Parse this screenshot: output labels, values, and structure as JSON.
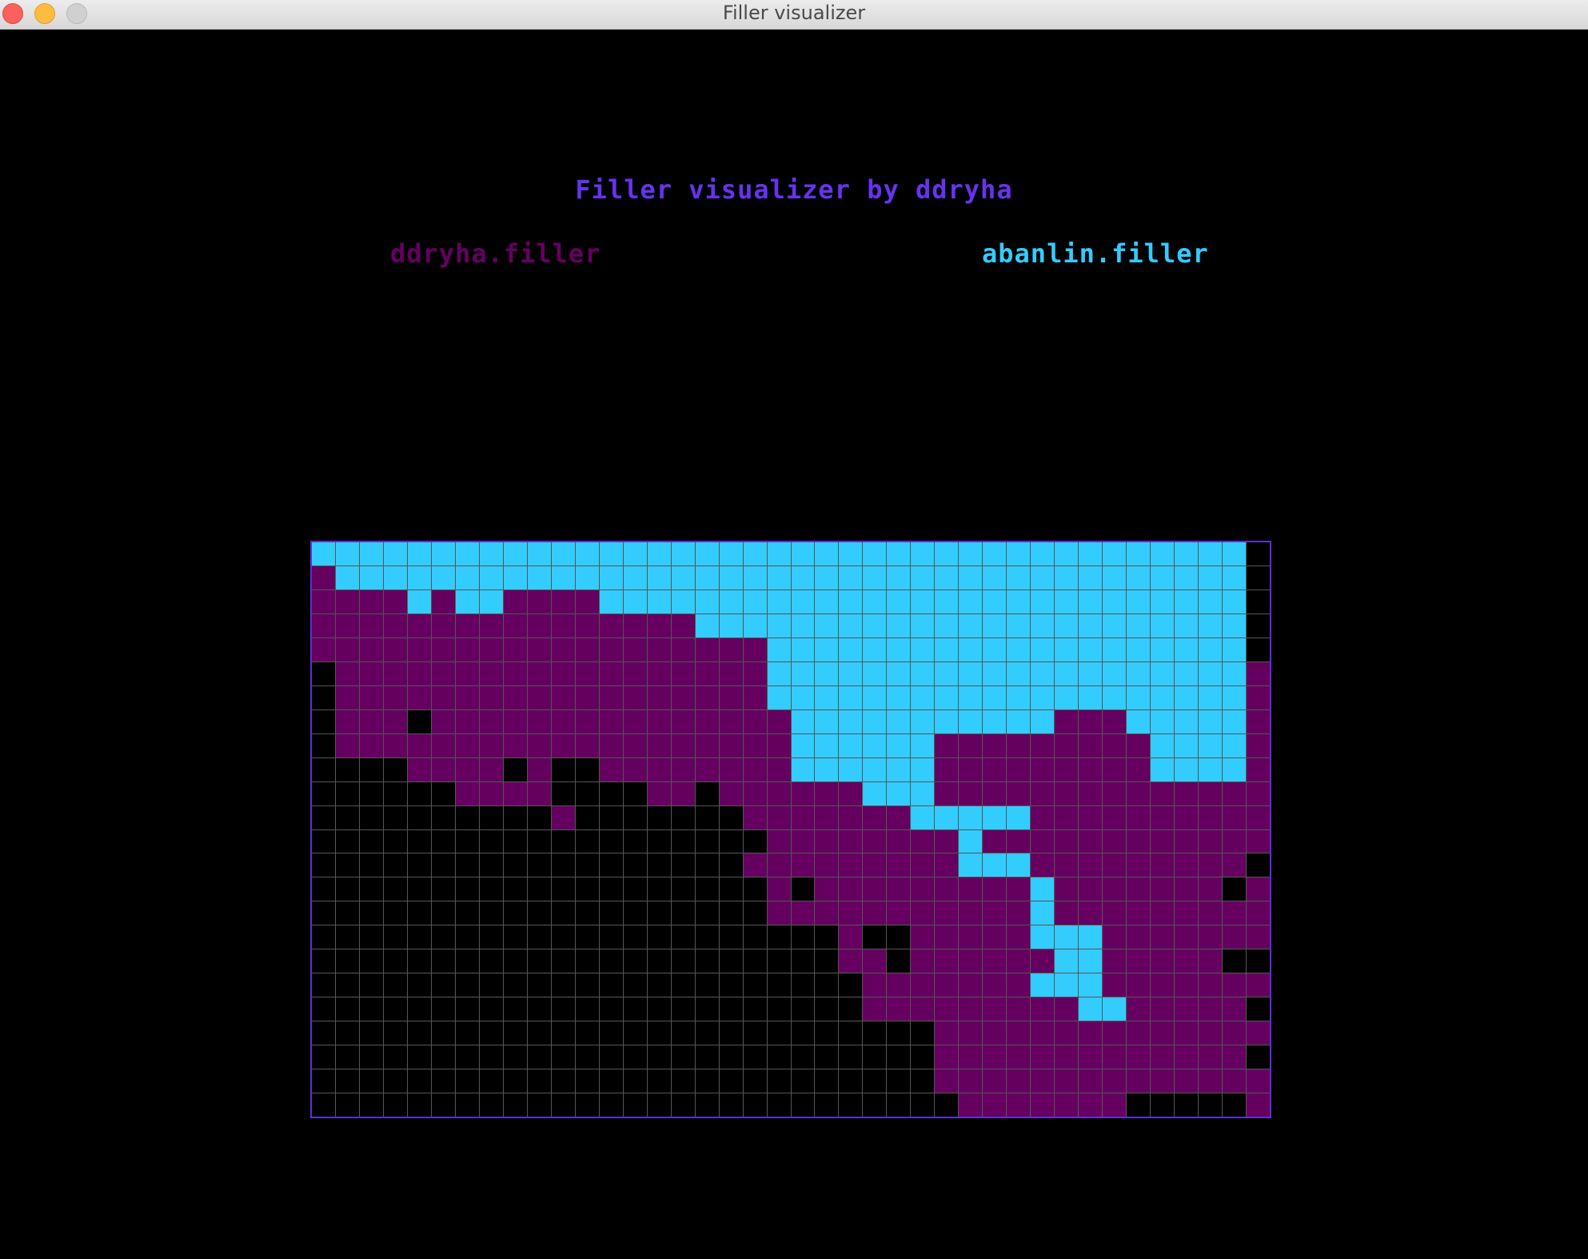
{
  "window": {
    "title": "Filler visualizer"
  },
  "heading": "Filler visualizer by ddryha",
  "players": [
    {
      "name": "ddryha.filler",
      "symbol": "O",
      "color": "#650060"
    },
    {
      "name": "abanlin.filler",
      "symbol": "X",
      "color": "#33ccff"
    }
  ],
  "colors": {
    "heading": "#6633ee",
    "empty": "#000000",
    "grid_line": "#555555",
    "frame": "#5b30d0"
  },
  "board": {
    "rows": 24,
    "cols": 40,
    "legend": {
      ".": "empty",
      "O": "ddryha.filler",
      "X": "abanlin.filler"
    },
    "map": [
      "XXXXXXXXXXXXXXXXXXXXXXXXXXXXXXXXXXXXXXX.",
      "OXXXXXXXXXXXXXXXXXXXXXXXXXXXXXXXXXXXXXX.",
      "OOOOXOXXOOOOXXXXXXXXXXXXXXXXXXXXXXXXXXX.",
      "OOOOOOOOOOOOOOOOXXXXXXXXXXXXXXXXXXXXXXX.",
      "OOOOOOOOOOOOOOOOOOOXXXXXXXXXXXXXXXXXXXX.",
      ".OOOOOOOOOOOOOOOOOOXXXXXXXXXXXXXXXXXXXXO",
      ".OOOOOOOOOOOOOOOOOOXXXXXXXXXXXXXXXXXXXXO",
      ".OOO.OOOOOOOOOOOOOOOXXXXXXXXXXXOOOXXXXXO",
      ".OOOOOOOOOOOOOOOOOOOXXXXXXOOOOOOOOOXXXXO",
      "....OOOO.O..OOOOOOOOXXXXXXOOOOOOOOOXXXXO",
      "......OOOO....OO.OOOOOOXXXOOOOOOOOOOOOOO",
      "..........O.......OOOOOOOXXXXXOOOOOOOOOO",
      "...................OOOOOOOOXOOOOOOOOOOOO",
      "..................OOOOOOOOOXXXOOOOOOOOO.",
      "...................O.OOOOOOOOOXOOOOOOO.O",
      "...................OOOOOOOOOOOXOOOOOOOOO",
      "......................O..OOOOOXXXOOOOOOO",
      "......................OO.OOOOOOXXOOOOO..",
      ".......................OOOOOOOXXXOOOOOOO",
      ".......................OOOOOOOOOXXOOOOO.",
      "..........................OOOOOOOOOOOOOO",
      "..........................OOOOOOOOOOOOO.",
      "..........................OOOOOOOOOOOOOO",
      "...........................OOOOOOO.....O"
    ]
  }
}
